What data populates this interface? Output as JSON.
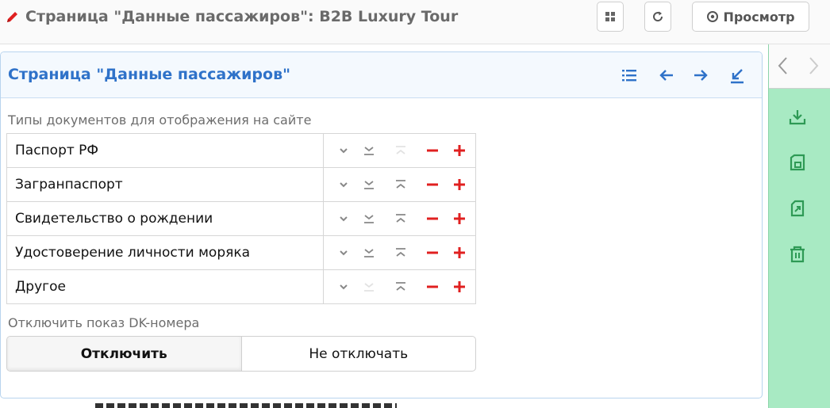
{
  "header": {
    "title": "Страница \"Данные пассажиров\": B2B Luxury Tour",
    "preview_label": "Просмотр"
  },
  "panel": {
    "title": "Страница \"Данные пассажиров\"",
    "documents_label": "Типы документов для отображения на сайте",
    "documents": [
      {
        "name": "Паспорт РФ",
        "down_enabled": true,
        "up_enabled": false
      },
      {
        "name": "Загранпаспорт",
        "down_enabled": true,
        "up_enabled": true
      },
      {
        "name": "Свидетельство о рождении",
        "down_enabled": true,
        "up_enabled": true
      },
      {
        "name": "Удостоверение личности моряка",
        "down_enabled": true,
        "up_enabled": true
      },
      {
        "name": "Другое",
        "down_enabled": false,
        "up_enabled": true
      }
    ],
    "dk_label": "Отключить показ DK-номера",
    "dk_options": {
      "on": "Отключить",
      "off": "Не отключать"
    },
    "dk_selected": "on"
  },
  "colors": {
    "accent": "#2f72c9",
    "danger": "#e02020",
    "sidebar_bg": "#a8eac3",
    "icon_green": "#2e9a55"
  }
}
